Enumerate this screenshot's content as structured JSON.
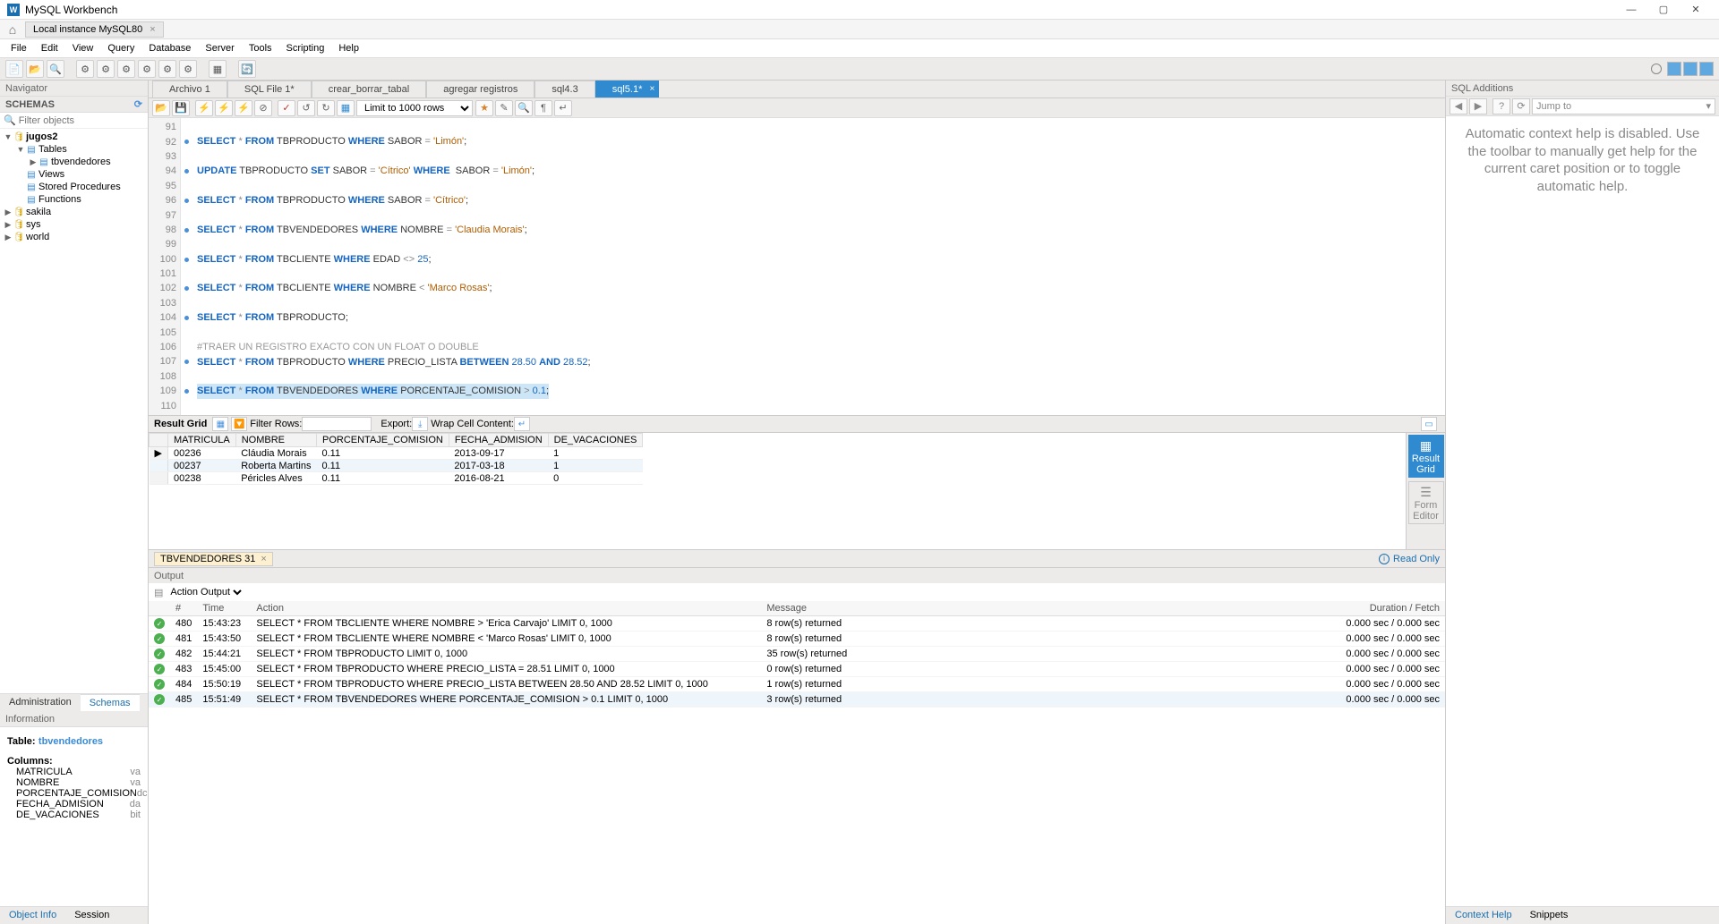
{
  "app_title": "MySQL Workbench",
  "connection_tab": "Local instance MySQL80",
  "menu": [
    "File",
    "Edit",
    "View",
    "Query",
    "Database",
    "Server",
    "Tools",
    "Scripting",
    "Help"
  ],
  "navigator": {
    "title": "Navigator",
    "section": "SCHEMAS",
    "filter_placeholder": "Filter objects",
    "tree": {
      "jugos2": "jugos2",
      "tables": "Tables",
      "tbvendedores": "tbvendedores",
      "views": "Views",
      "sp": "Stored Procedures",
      "functions": "Functions",
      "sakila": "sakila",
      "sys": "sys",
      "world": "world"
    },
    "tabs": {
      "admin": "Administration",
      "schemas": "Schemas"
    }
  },
  "information": {
    "header": "Information",
    "table_label": "Table:",
    "table_name": "tbvendedores",
    "columns_label": "Columns:",
    "columns": [
      {
        "name": "MATRICULA",
        "type": "va"
      },
      {
        "name": "NOMBRE",
        "type": "va"
      },
      {
        "name": "PORCENTAJE_COMISION",
        "type": "dc"
      },
      {
        "name": "FECHA_ADMISION",
        "type": "da"
      },
      {
        "name": "DE_VACACIONES",
        "type": "bit"
      }
    ],
    "tabs": {
      "object": "Object Info",
      "session": "Session"
    }
  },
  "file_tabs": [
    "Archivo 1",
    "SQL File 1*",
    "crear_borrar_tabal",
    "agregar registros",
    "sql4.3",
    "sql5.1*"
  ],
  "limit": "Limit to 1000 rows",
  "code_lines": [
    {
      "n": 91,
      "dot": false,
      "html": ""
    },
    {
      "n": 92,
      "dot": true,
      "html": "<span class='kw'>SELECT</span> <span class='op'>*</span> <span class='kw'>FROM</span> TBPRODUCTO <span class='kw'>WHERE</span> SABOR <span class='op'>=</span> <span class='str'>'Limón'</span>;"
    },
    {
      "n": 93,
      "dot": false,
      "html": ""
    },
    {
      "n": 94,
      "dot": true,
      "html": "<span class='kw'>UPDATE</span> TBPRODUCTO <span class='kw'>SET</span> SABOR <span class='op'>=</span> <span class='str'>'Cítrico'</span> <span class='kw'>WHERE</span>  SABOR <span class='op'>=</span> <span class='str'>'Limón'</span>;"
    },
    {
      "n": 95,
      "dot": false,
      "html": ""
    },
    {
      "n": 96,
      "dot": true,
      "html": "<span class='kw'>SELECT</span> <span class='op'>*</span> <span class='kw'>FROM</span> TBPRODUCTO <span class='kw'>WHERE</span> SABOR <span class='op'>=</span> <span class='str'>'Cítrico'</span>;"
    },
    {
      "n": 97,
      "dot": false,
      "html": ""
    },
    {
      "n": 98,
      "dot": true,
      "html": "<span class='kw'>SELECT</span> <span class='op'>*</span> <span class='kw'>FROM</span> TBVENDEDORES <span class='kw'>WHERE</span> NOMBRE <span class='op'>=</span> <span class='str'>'Claudia Morais'</span>;"
    },
    {
      "n": 99,
      "dot": false,
      "html": ""
    },
    {
      "n": 100,
      "dot": true,
      "html": "<span class='kw'>SELECT</span> <span class='op'>*</span> <span class='kw'>FROM</span> TBCLIENTE <span class='kw'>WHERE</span> EDAD <span class='op'>&lt;&gt;</span> <span class='num'>25</span>;"
    },
    {
      "n": 101,
      "dot": false,
      "html": ""
    },
    {
      "n": 102,
      "dot": true,
      "html": "<span class='kw'>SELECT</span> <span class='op'>*</span> <span class='kw'>FROM</span> TBCLIENTE <span class='kw'>WHERE</span> NOMBRE <span class='op'>&lt;</span> <span class='str'>'Marco Rosas'</span>;"
    },
    {
      "n": 103,
      "dot": false,
      "html": ""
    },
    {
      "n": 104,
      "dot": true,
      "html": "<span class='kw'>SELECT</span> <span class='op'>*</span> <span class='kw'>FROM</span> TBPRODUCTO;"
    },
    {
      "n": 105,
      "dot": false,
      "html": ""
    },
    {
      "n": 106,
      "dot": false,
      "html": "<span class='cmt'>#TRAER UN REGISTRO EXACTO CON UN FLOAT O DOUBLE</span>"
    },
    {
      "n": 107,
      "dot": true,
      "html": "<span class='kw'>SELECT</span> <span class='op'>*</span> <span class='kw'>FROM</span> TBPRODUCTO <span class='kw'>WHERE</span> PRECIO_LISTA <span class='kw'>BETWEEN</span> <span class='num'>28.50</span> <span class='kw'>AND</span> <span class='num'>28.52</span>;"
    },
    {
      "n": 108,
      "dot": false,
      "html": ""
    },
    {
      "n": 109,
      "dot": true,
      "html": "<span class='hl'><span class='kw'>SELECT</span> <span class='op'>*</span> <span class='kw'>FROM</span> TBVENDEDORES <span class='kw'>WHERE</span> PORCENTAJE_COMISION <span class='op'>&gt;</span> <span class='num'>0.1</span>;</span>"
    },
    {
      "n": 110,
      "dot": false,
      "html": ""
    }
  ],
  "result": {
    "label": "Result Grid",
    "filter_label": "Filter Rows:",
    "export_label": "Export:",
    "wrap_label": "Wrap Cell Content:",
    "columns": [
      "MATRICULA",
      "NOMBRE",
      "PORCENTAJE_COMISION",
      "FECHA_ADMISION",
      "DE_VACACIONES"
    ],
    "rows": [
      [
        "00236",
        "Cláudia Morais",
        "0.11",
        "2013-09-17",
        "1"
      ],
      [
        "00237",
        "Roberta Martins",
        "0.11",
        "2017-03-18",
        "1"
      ],
      [
        "00238",
        "Péricles Alves",
        "0.11",
        "2016-08-21",
        "0"
      ]
    ],
    "side": {
      "grid": "Result\nGrid",
      "form": "Form\nEditor"
    },
    "tab": "TBVENDEDORES 31",
    "readonly": "Read Only"
  },
  "output": {
    "header": "Output",
    "selector": "Action Output",
    "columns": [
      "",
      "#",
      "Time",
      "Action",
      "Message",
      "Duration / Fetch"
    ],
    "rows": [
      {
        "n": "480",
        "t": "15:43:23",
        "a": "SELECT * FROM TBCLIENTE WHERE NOMBRE > 'Erica Carvajo' LIMIT 0, 1000",
        "m": "8 row(s) returned",
        "d": "0.000 sec / 0.000 sec"
      },
      {
        "n": "481",
        "t": "15:43:50",
        "a": "SELECT * FROM TBCLIENTE WHERE NOMBRE < 'Marco Rosas' LIMIT 0, 1000",
        "m": "8 row(s) returned",
        "d": "0.000 sec / 0.000 sec"
      },
      {
        "n": "482",
        "t": "15:44:21",
        "a": "SELECT * FROM TBPRODUCTO LIMIT 0, 1000",
        "m": "35 row(s) returned",
        "d": "0.000 sec / 0.000 sec"
      },
      {
        "n": "483",
        "t": "15:45:00",
        "a": "SELECT * FROM TBPRODUCTO WHERE PRECIO_LISTA = 28.51 LIMIT 0, 1000",
        "m": "0 row(s) returned",
        "d": "0.000 sec / 0.000 sec"
      },
      {
        "n": "484",
        "t": "15:50:19",
        "a": "SELECT * FROM TBPRODUCTO WHERE PRECIO_LISTA BETWEEN 28.50 AND 28.52 LIMIT 0, 1000",
        "m": "1 row(s) returned",
        "d": "0.000 sec / 0.000 sec"
      },
      {
        "n": "485",
        "t": "15:51:49",
        "a": "SELECT * FROM TBVENDEDORES WHERE PORCENTAJE_COMISION > 0.1 LIMIT 0, 1000",
        "m": "3 row(s) returned",
        "d": "0.000 sec / 0.000 sec"
      }
    ]
  },
  "sql_additions": {
    "header": "SQL Additions",
    "jump": "Jump to",
    "body": "Automatic context help is disabled. Use the toolbar to manually get help for the current caret position or to toggle automatic help.",
    "tabs": {
      "context": "Context Help",
      "snippets": "Snippets"
    }
  }
}
